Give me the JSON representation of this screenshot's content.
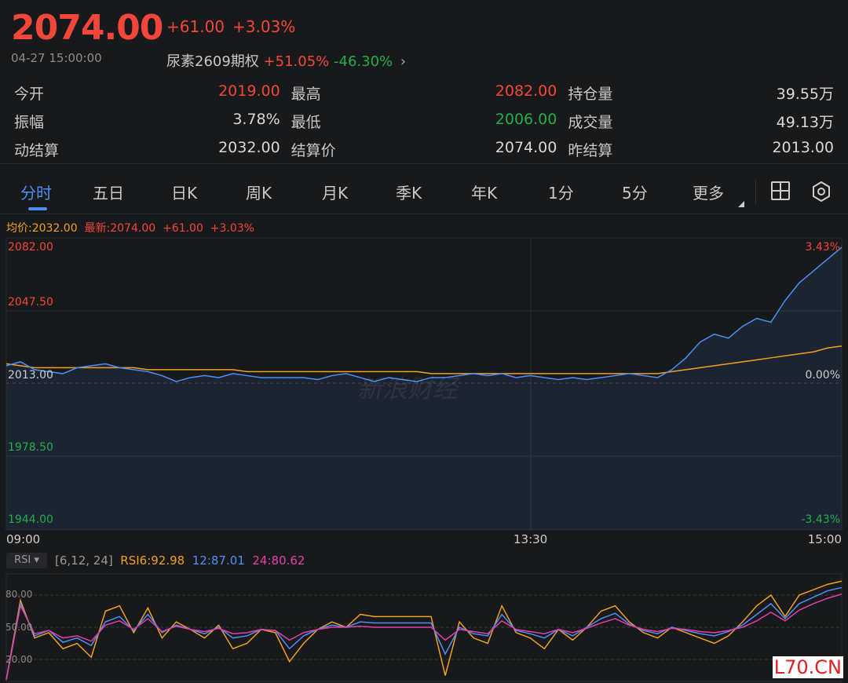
{
  "header": {
    "price": "2074.00",
    "change": "+61.00",
    "change_pct": "+3.03%",
    "datetime": "04-27 15:00:00",
    "option_name": "尿素2609期权",
    "option_up": "+51.05%",
    "option_down": "-46.30%",
    "chevron": "chevron-right-icon"
  },
  "stats": [
    [
      {
        "k": "今开",
        "v": "2019.00",
        "c": "red"
      },
      {
        "k": "最高",
        "v": "2082.00",
        "c": "red"
      },
      {
        "k": "持仓量",
        "v": "39.55万",
        "c": ""
      }
    ],
    [
      {
        "k": "振幅",
        "v": "3.78%",
        "c": ""
      },
      {
        "k": "最低",
        "v": "2006.00",
        "c": "green"
      },
      {
        "k": "成交量",
        "v": "49.13万",
        "c": ""
      }
    ],
    [
      {
        "k": "动结算",
        "v": "2032.00",
        "c": ""
      },
      {
        "k": "结算价",
        "v": "2074.00",
        "c": ""
      },
      {
        "k": "昨结算",
        "v": "2013.00",
        "c": ""
      }
    ]
  ],
  "tabs": [
    "分时",
    "五日",
    "日K",
    "周K",
    "月K",
    "季K",
    "年K",
    "1分",
    "5分",
    "更多"
  ],
  "legend": {
    "avg": "均价:2032.00",
    "latest": "最新:2074.00",
    "change": "+61.00",
    "pct": "+3.03%"
  },
  "colors": {
    "up": "#f2463a",
    "down": "#1fae4a",
    "price": "#4d8ef7",
    "avg": "#f0a020",
    "rsi6": "#f0a020",
    "rsi12": "#4d8ef7",
    "rsi24": "#e040a8"
  },
  "axis": {
    "y_left": [
      "2082.00",
      "2047.50",
      "2013.00",
      "1978.50",
      "1944.00"
    ],
    "y_right": [
      "3.43%",
      "0.00%",
      "-3.43%"
    ],
    "x": [
      "09:00",
      "13:30",
      "15:00"
    ]
  },
  "watermark": "新浪财经",
  "rsi": {
    "button": "RSI ▾",
    "params": "[6,12, 24]",
    "rsi6": "RSI6:92.98",
    "rsi12": "12:87.01",
    "rsi24": "24:80.62",
    "ticks": [
      "80.00",
      "50.00",
      "20.00"
    ]
  },
  "corner_mark": "L70.CN",
  "chart_data": {
    "type": "line",
    "ylim": [
      1944,
      2082
    ],
    "series": [
      {
        "name": "price",
        "values": [
          2022,
          2024,
          2020,
          2019,
          2018,
          2021,
          2022,
          2023,
          2021,
          2020,
          2019,
          2017,
          2014,
          2016,
          2017,
          2016,
          2018,
          2017,
          2016,
          2016,
          2016,
          2016,
          2015,
          2017,
          2018,
          2016,
          2014,
          2016,
          2015,
          2014,
          2016,
          2016,
          2017,
          2018,
          2017,
          2018,
          2016,
          2017,
          2016,
          2015,
          2016,
          2015,
          2016,
          2017,
          2018,
          2017,
          2016,
          2020,
          2026,
          2034,
          2038,
          2036,
          2042,
          2046,
          2044,
          2055,
          2064,
          2070,
          2076,
          2082
        ]
      },
      {
        "name": "avg",
        "values": [
          2023,
          2022,
          2021,
          2021,
          2021,
          2021,
          2021,
          2021,
          2021,
          2021,
          2020,
          2020,
          2020,
          2020,
          2020,
          2020,
          2020,
          2019,
          2019,
          2019,
          2019,
          2019,
          2019,
          2019,
          2019,
          2019,
          2019,
          2019,
          2019,
          2019,
          2018,
          2018,
          2018,
          2018,
          2018,
          2018,
          2018,
          2018,
          2018,
          2018,
          2018,
          2018,
          2018,
          2018,
          2018,
          2018,
          2018,
          2019,
          2020,
          2021,
          2022,
          2023,
          2024,
          2025,
          2026,
          2027,
          2028,
          2029,
          2031,
          2032
        ]
      }
    ],
    "rsi_ylim": [
      0,
      100
    ],
    "rsi_series": [
      {
        "name": "RSI6",
        "values": [
          0,
          75,
          40,
          45,
          30,
          35,
          22,
          65,
          70,
          45,
          68,
          40,
          55,
          48,
          40,
          52,
          30,
          35,
          48,
          45,
          18,
          35,
          48,
          55,
          50,
          62,
          60,
          60,
          60,
          60,
          60,
          5,
          55,
          40,
          35,
          70,
          45,
          40,
          30,
          48,
          38,
          50,
          65,
          70,
          55,
          45,
          40,
          50,
          45,
          40,
          35,
          42,
          55,
          70,
          80,
          60,
          80,
          85,
          90,
          93
        ]
      },
      {
        "name": "RSI12",
        "values": [
          0,
          72,
          42,
          47,
          36,
          40,
          33,
          55,
          60,
          47,
          62,
          45,
          52,
          48,
          44,
          50,
          40,
          42,
          48,
          47,
          30,
          42,
          48,
          52,
          50,
          55,
          54,
          54,
          54,
          54,
          54,
          25,
          50,
          44,
          42,
          62,
          47,
          44,
          40,
          48,
          42,
          50,
          58,
          63,
          53,
          47,
          44,
          50,
          47,
          44,
          42,
          46,
          52,
          62,
          72,
          58,
          72,
          78,
          84,
          87
        ]
      },
      {
        "name": "RSI24",
        "values": [
          0,
          70,
          44,
          47,
          40,
          42,
          37,
          52,
          56,
          48,
          58,
          46,
          51,
          48,
          46,
          49,
          44,
          45,
          48,
          47,
          38,
          45,
          48,
          50,
          50,
          51,
          50,
          50,
          50,
          50,
          50,
          38,
          48,
          46,
          44,
          56,
          48,
          46,
          44,
          48,
          45,
          49,
          54,
          58,
          52,
          48,
          46,
          49,
          48,
          46,
          45,
          47,
          50,
          56,
          64,
          56,
          66,
          72,
          77,
          81
        ]
      }
    ]
  }
}
